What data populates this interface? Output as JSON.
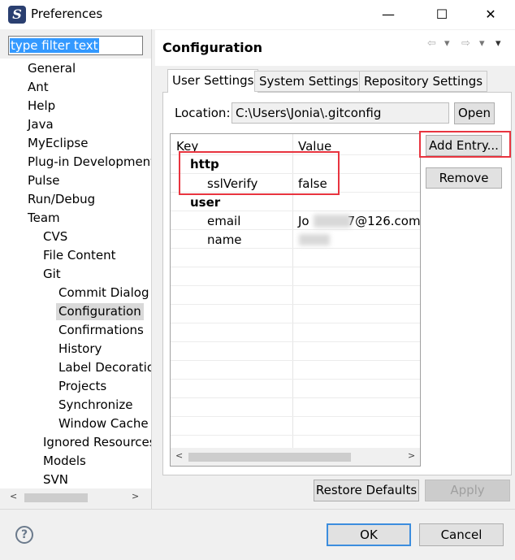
{
  "window": {
    "title": "Preferences",
    "app_icon_letter": "S",
    "minimize": "—",
    "maximize": "☐",
    "close": "✕"
  },
  "filter": {
    "text": "type filter text"
  },
  "tree": [
    {
      "label": "General"
    },
    {
      "label": "Ant"
    },
    {
      "label": "Help"
    },
    {
      "label": "Java"
    },
    {
      "label": "MyEclipse"
    },
    {
      "label": "Plug-in Development"
    },
    {
      "label": "Pulse"
    },
    {
      "label": "Run/Debug"
    },
    {
      "label": "Team"
    },
    {
      "label": "CVS"
    },
    {
      "label": "File Content"
    },
    {
      "label": "Git"
    },
    {
      "label": "Commit Dialog"
    },
    {
      "label": "Configuration"
    },
    {
      "label": "Confirmations"
    },
    {
      "label": "History"
    },
    {
      "label": "Label Decorations"
    },
    {
      "label": "Projects"
    },
    {
      "label": "Synchronize"
    },
    {
      "label": "Window Cache"
    },
    {
      "label": "Ignored Resources"
    },
    {
      "label": "Models"
    },
    {
      "label": "SVN"
    }
  ],
  "scroll_arrows": {
    "left": "<",
    "right": ">"
  },
  "page": {
    "title": "Configuration",
    "nav_back": "⇦",
    "nav_drop1": "▾",
    "nav_fwd": "⇨",
    "nav_drop2": "▾",
    "nav_menu": "▾"
  },
  "tabs": [
    "User Settings",
    "System Settings",
    "Repository Settings"
  ],
  "location": {
    "label": "Location:",
    "value": "C:\\Users\\Jonia\\.gitconfig",
    "open_button": "Open"
  },
  "table": {
    "headers": {
      "key": "Key",
      "value": "Value"
    },
    "rows": [
      {
        "key": "http",
        "value": ""
      },
      {
        "key": "sslVerify",
        "value": "false"
      },
      {
        "key": "user",
        "value": ""
      },
      {
        "key": "email",
        "value_prefix": "Jo",
        "value_suffix": "7@126.com"
      },
      {
        "key": "name",
        "value": ""
      }
    ]
  },
  "side_buttons": {
    "add_entry": "Add Entry...",
    "remove": "Remove"
  },
  "page_buttons": {
    "restore_defaults": "Restore Defaults",
    "apply": "Apply"
  },
  "dialog_buttons": {
    "ok": "OK",
    "cancel": "Cancel",
    "help": "?"
  },
  "colors": {
    "highlight": "#e8343f",
    "ok_border": "#3c8dde",
    "selection": "#3399ff"
  }
}
